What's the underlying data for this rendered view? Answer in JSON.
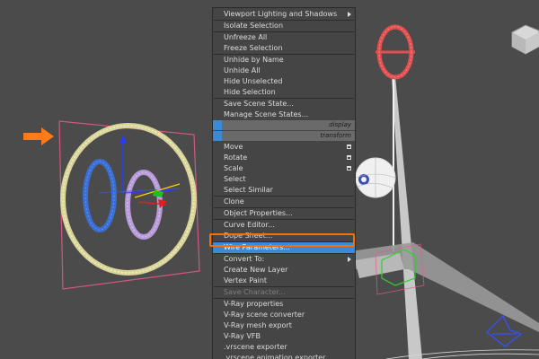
{
  "menu": {
    "items": [
      {
        "label": "Viewport Lighting and Shadows",
        "submenu": true
      },
      {
        "label": "Isolate Selection"
      },
      {
        "label": "Unfreeze All"
      },
      {
        "label": "Freeze Selection"
      },
      {
        "label": "Unhide by Name"
      },
      {
        "label": "Unhide All"
      },
      {
        "label": "Hide Unselected"
      },
      {
        "label": "Hide Selection"
      },
      {
        "label": "Save Scene State..."
      },
      {
        "label": "Manage Scene States..."
      },
      {
        "label": "Move",
        "option": true
      },
      {
        "label": "Rotate",
        "option": true
      },
      {
        "label": "Scale",
        "option": true
      },
      {
        "label": "Select"
      },
      {
        "label": "Select Similar"
      },
      {
        "label": "Clone"
      },
      {
        "label": "Object Properties..."
      },
      {
        "label": "Curve Editor..."
      },
      {
        "label": "Dope Sheet..."
      },
      {
        "label": "Wire Parameters...",
        "highlighted": true
      },
      {
        "label": "Convert To:",
        "submenu": true
      },
      {
        "label": "Create New Layer"
      },
      {
        "label": "Vertex Paint"
      },
      {
        "label": "Save Character...",
        "disabled": true
      },
      {
        "label": "V-Ray properties"
      },
      {
        "label": "V-Ray scene converter"
      },
      {
        "label": "V-Ray mesh export"
      },
      {
        "label": "V-Ray VFB"
      },
      {
        "label": ".vrscene exporter"
      },
      {
        "label": ".vrscene animation exporter"
      }
    ],
    "quad_headers": {
      "display": "display",
      "transform": "transform"
    }
  },
  "colors": {
    "highlight": "#3a8ad8",
    "annotation": "#ff6c00"
  },
  "icons": {
    "annotation_arrow_left": "orange-arrow-icon",
    "annotation_arrow_menu": "orange-arrow-icon",
    "viewcube": "viewcube-icon",
    "view_gizmo": "view-navigation-icon"
  }
}
